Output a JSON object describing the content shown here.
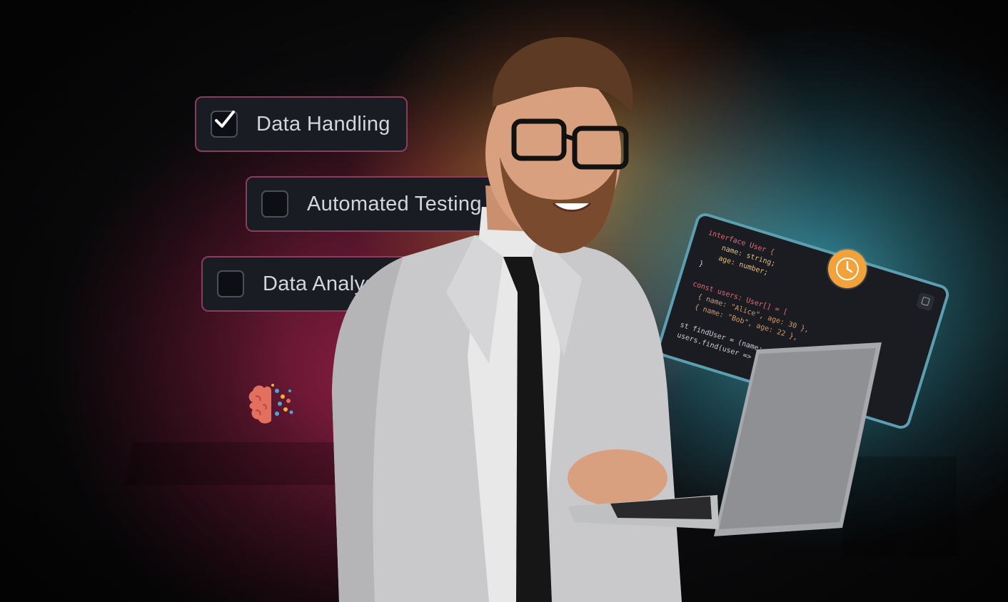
{
  "checklist": {
    "items": [
      {
        "label": "Data Handling",
        "checked": true
      },
      {
        "label": "Automated Testing",
        "checked": false
      },
      {
        "label": "Data Analysis",
        "checked": false
      }
    ]
  },
  "code_panel": {
    "lines": [
      "interface User {",
      "    name: string;",
      "    age: number;",
      "}",
      "",
      "const users: User[] = [",
      "  { name: \"Alice\", age: 30 },",
      "  { name: \"Bob\", age: 22 },",
      "",
      "st findUser = (name: string): User",
      "users.find(user => user.name ..."
    ]
  },
  "icons": {
    "clock": "clock-icon",
    "brain": "brain-icon",
    "copy": "copy-icon",
    "check": "check-icon"
  },
  "colors": {
    "card_border": "#8a3d5a",
    "card_bg": "#1a1c24",
    "clock_bg": "#f2a23a",
    "code_border": "#5b9fb0"
  }
}
